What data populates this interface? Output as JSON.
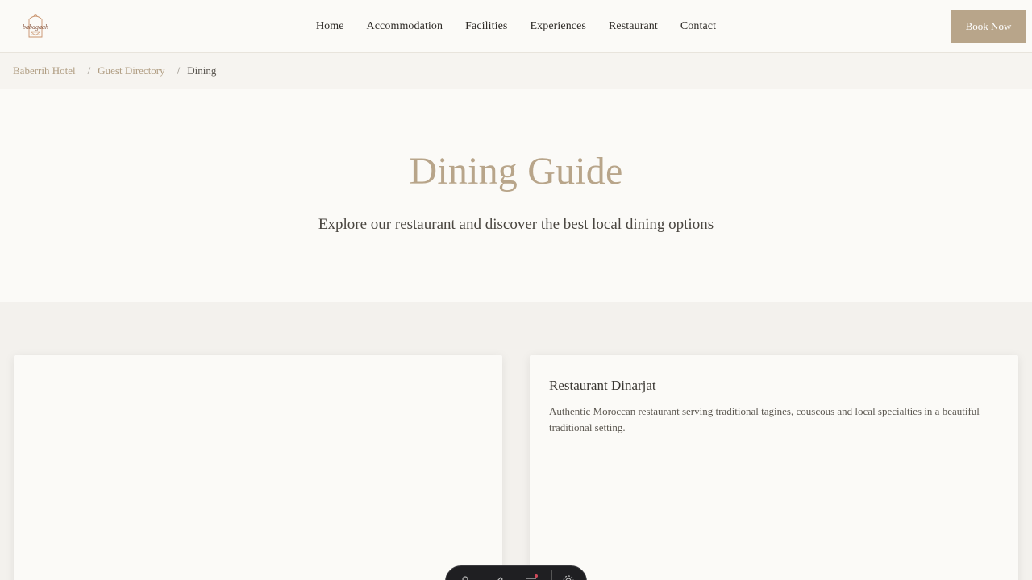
{
  "header": {
    "logo_alt": "babagaah",
    "nav": [
      "Home",
      "Accommodation",
      "Facilities",
      "Experiences",
      "Restaurant",
      "Contact"
    ],
    "book_label": "Book Now"
  },
  "breadcrumb": {
    "items": [
      "Baberrih Hotel",
      "Guest Directory"
    ],
    "current": "Dining"
  },
  "hero": {
    "title": "Dining Guide",
    "subtitle": "Explore our restaurant and discover the best local dining options"
  },
  "cards": [
    {
      "title": "Restaurant Dinarjat",
      "description": "Authentic Moroccan restaurant serving traditional tagines, couscous and local specialties in a beautiful traditional setting."
    }
  ],
  "colors": {
    "accent": "#b8a58a",
    "background": "#f3f1ed",
    "surface": "#fbfaf7",
    "text": "#3d3a35"
  },
  "toolbar_icons": [
    "user-icon",
    "pen-icon",
    "list-icon",
    "gear-icon"
  ]
}
